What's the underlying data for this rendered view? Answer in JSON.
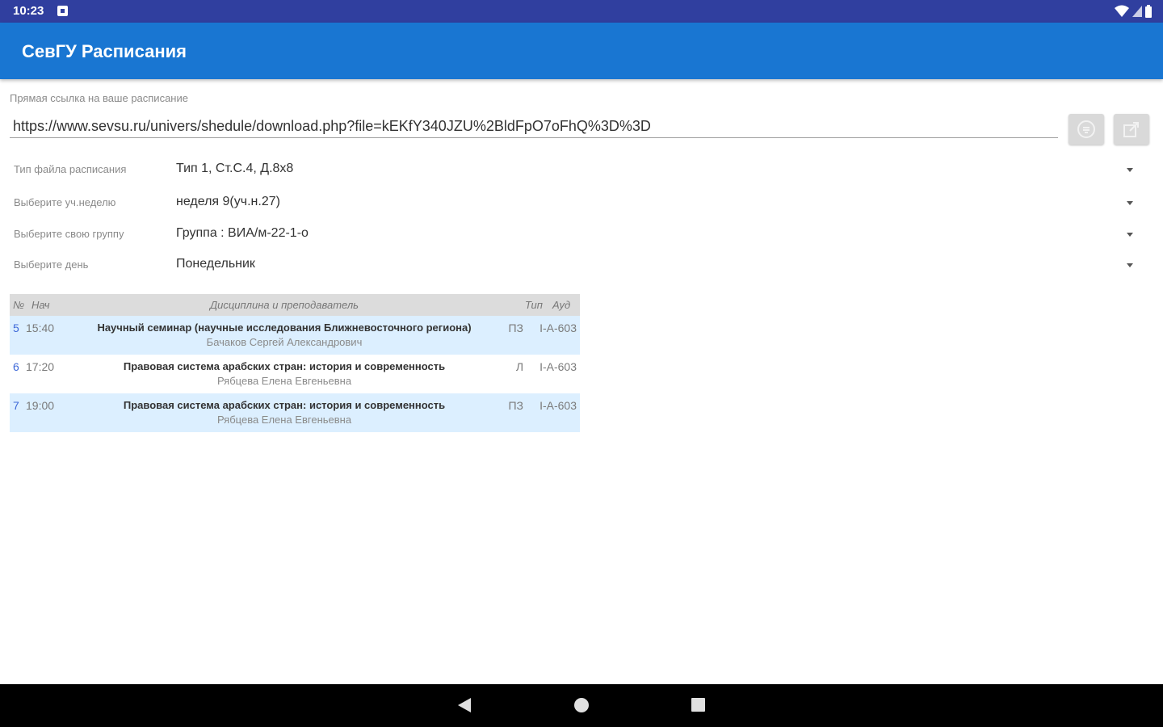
{
  "status_bar": {
    "time": "10:23"
  },
  "app_bar": {
    "title": "СевГУ Расписания"
  },
  "link": {
    "label": "Прямая ссылка на ваше расписание",
    "value": "https://www.sevsu.ru/univers/shedule/download.php?file=kEKfY340JZU%2BldFpO7oFhQ%3D%3D"
  },
  "form": {
    "file_type": {
      "label": "Тип файла расписания",
      "value": "Тип 1, Ст.С.4, Д.8х8"
    },
    "week": {
      "label": "Выберите уч.неделю",
      "value": "неделя 9(уч.н.27)"
    },
    "group": {
      "label": "Выберите свою группу",
      "value": "Группа : ВИА/м-22-1-о"
    },
    "day": {
      "label": "Выберите день",
      "value": "Понедельник"
    }
  },
  "table": {
    "headers": {
      "num": "№",
      "start": "Нач",
      "subject": "Дисциплина и преподаватель",
      "type": "Тип",
      "room": "Ауд"
    },
    "rows": [
      {
        "num": "5",
        "time": "15:40",
        "subject": "Научный семинар (научные исследования Ближневосточного региона)",
        "teacher": "Бачаков Сергей Александрович",
        "type": "ПЗ",
        "room": "I-А-603"
      },
      {
        "num": "6",
        "time": "17:20",
        "subject": "Правовая система арабских стран: история и современность",
        "teacher": "Рябцева Елена Евгеньевна",
        "type": "Л",
        "room": "I-А-603"
      },
      {
        "num": "7",
        "time": "19:00",
        "subject": "Правовая система арабских стран: история и современность",
        "teacher": "Рябцева Елена Евгеньевна",
        "type": "ПЗ",
        "room": "I-А-603"
      }
    ]
  },
  "icons": {
    "save": "save-icon",
    "share": "share-icon",
    "wifi": "wifi-icon",
    "cell_signal": "cell-signal-icon",
    "battery": "battery-icon"
  },
  "colors": {
    "status_bar": "#303f9f",
    "app_bar": "#1976d2",
    "row_highlight": "#dcefff",
    "table_header": "#dcdcdc"
  }
}
